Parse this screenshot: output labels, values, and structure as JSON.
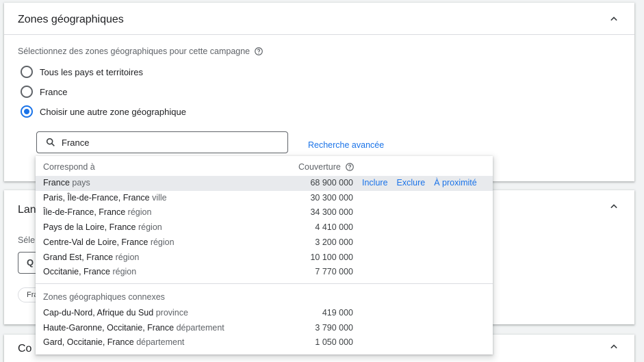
{
  "locations_card": {
    "title": "Zones géographiques",
    "prompt": "Sélectionnez des zones géographiques pour cette campagne",
    "options": [
      {
        "label": "Tous les pays et territoires",
        "selected": false
      },
      {
        "label": "France",
        "selected": false
      },
      {
        "label": "Choisir une autre zone géographique",
        "selected": true
      }
    ],
    "search": {
      "value": "France",
      "placeholder": ""
    },
    "advanced_search_label": "Recherche avancée"
  },
  "languages_card": {
    "title_partial": "Lan",
    "subtitle_partial": "Séle",
    "input_partial": "Q",
    "chip_partial": "Fra"
  },
  "third_card": {
    "title_partial": "Co"
  },
  "dropdown": {
    "header_match": "Correspond à",
    "header_reach": "Couverture",
    "rows": [
      {
        "name": "France",
        "type": "pays",
        "reach": "68 900 000",
        "hover": true
      },
      {
        "name": "Paris, Île-de-France, France",
        "type": "ville",
        "reach": "30 300 000"
      },
      {
        "name": "Île-de-France, France",
        "type": "région",
        "reach": "34 300 000"
      },
      {
        "name": "Pays de la Loire, France",
        "type": "région",
        "reach": "4 410 000"
      },
      {
        "name": "Centre-Val de Loire, France",
        "type": "région",
        "reach": "3 200 000"
      },
      {
        "name": "Grand Est, France",
        "type": "région",
        "reach": "10 100 000"
      },
      {
        "name": "Occitanie, France",
        "type": "région",
        "reach": "7 770 000"
      }
    ],
    "actions": {
      "include": "Inclure",
      "exclude": "Exclure",
      "nearby": "À proximité"
    },
    "related_section": "Zones géographiques connexes",
    "related_rows": [
      {
        "name": "Cap-du-Nord, Afrique du Sud",
        "type": "province",
        "reach": "419 000"
      },
      {
        "name": "Haute-Garonne, Occitanie, France",
        "type": "département",
        "reach": "3 790 000"
      },
      {
        "name": "Gard, Occitanie, France",
        "type": "département",
        "reach": "1 050 000"
      }
    ]
  },
  "colors": {
    "accent": "#1a73e8",
    "hover": "#e8eaed",
    "text_secondary": "#5f6368"
  }
}
